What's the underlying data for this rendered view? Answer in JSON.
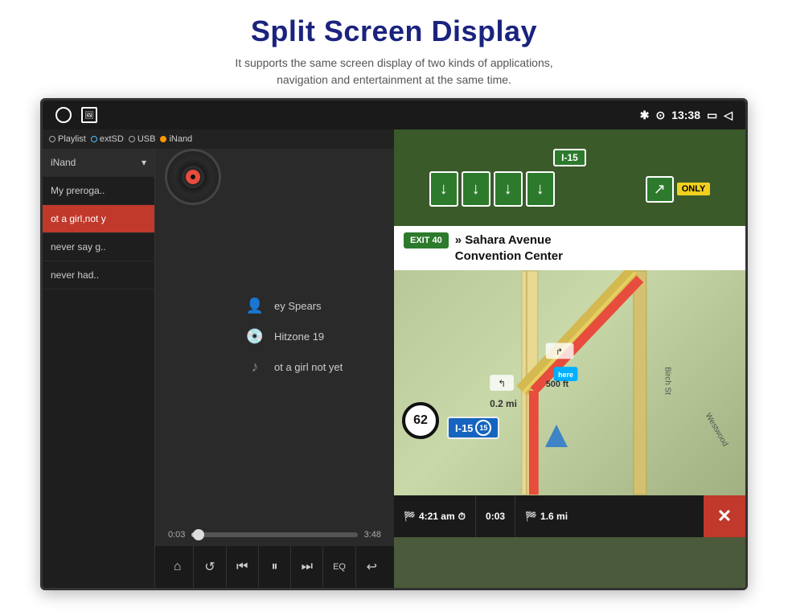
{
  "page": {
    "title": "Split Screen Display",
    "subtitle": "It supports the same screen display of two kinds of applications,\nnavigation and entertainment at the same time."
  },
  "statusBar": {
    "time": "13:38",
    "bluetooth": "✱",
    "location": "⊙"
  },
  "musicPlayer": {
    "sourceLabel": "iNand",
    "tabs": [
      {
        "label": "Playlist",
        "dotColor": "white"
      },
      {
        "label": "extSD",
        "dotColor": "blue"
      },
      {
        "label": "USB",
        "dotColor": "white"
      },
      {
        "label": "iNand",
        "dotColor": "orange"
      }
    ],
    "playlist": [
      {
        "title": "My preroga..",
        "active": false
      },
      {
        "title": "ot a girl,not y",
        "active": true,
        "highlighted": true
      },
      {
        "title": "never say g..",
        "active": false
      },
      {
        "title": "never had..",
        "active": false
      }
    ],
    "trackArtist": "ey Spears",
    "trackAlbum": "Hitzone 19",
    "trackTitle": "ot a girl not yet",
    "timeElapsed": "0:03",
    "timeTotal": "3:48",
    "progressPercent": 4,
    "controls": [
      "⌂",
      "↺",
      "⏮",
      "⏸",
      "⏭",
      "EQ",
      "↩"
    ]
  },
  "navigation": {
    "highway": "I-15",
    "exitNumber": "EXIT 40",
    "direction": "» Sahara Avenue\nConvention Center",
    "streetSigns": [
      "↓",
      "↓",
      "↓",
      "↓"
    ],
    "onlySign": "ONLY",
    "distanceToTurn": "0.2 mi",
    "turnDistanceFt": "500 ft",
    "speed": "62",
    "highwayShield": "15",
    "eta": "4:21 am",
    "duration": "0:03",
    "distanceRemaining": "1.6 mi"
  }
}
